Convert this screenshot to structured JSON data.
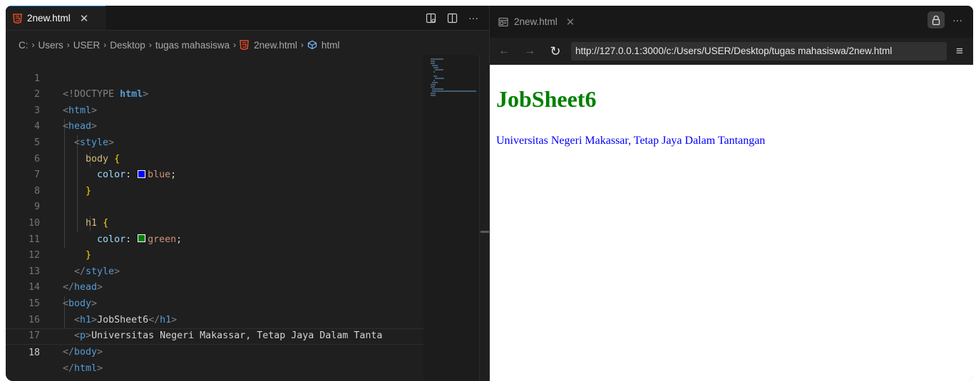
{
  "editor": {
    "tab": {
      "label": "2new.html",
      "close": "✕",
      "icon": "html5-icon"
    },
    "actions": {
      "more": "···"
    },
    "breadcrumb": [
      "C:",
      "Users",
      "USER",
      "Desktop",
      "tugas mahasiswa",
      "2new.html",
      "html"
    ],
    "breadcrumb_sep": "›",
    "active_line": 18,
    "lines": [
      {
        "n": "1"
      },
      {
        "n": "2"
      },
      {
        "n": "3"
      },
      {
        "n": "4"
      },
      {
        "n": "5"
      },
      {
        "n": "6"
      },
      {
        "n": "7"
      },
      {
        "n": "8"
      },
      {
        "n": "9"
      },
      {
        "n": "10"
      },
      {
        "n": "11"
      },
      {
        "n": "12"
      },
      {
        "n": "13"
      },
      {
        "n": "14"
      },
      {
        "n": "15"
      },
      {
        "n": "16"
      },
      {
        "n": "17"
      },
      {
        "n": "18"
      }
    ],
    "code": {
      "doctype_open": "<!DOCTYPE ",
      "doctype_kw": "html",
      "doctype_close": ">",
      "tag_html": "html",
      "tag_head": "head",
      "tag_style": "style",
      "tag_body": "body",
      "tag_h1": "h1",
      "tag_p": "p",
      "sel_body": "body",
      "sel_h1": "h1",
      "brace_open": "{",
      "brace_close": "}",
      "prop_color": "color",
      "colon": ": ",
      "val_blue": "blue",
      "val_green": "green",
      "semi": ";",
      "swatch_blue": "#0000ff",
      "swatch_green": "#008000",
      "h1_text": "JobSheet6",
      "p_text": "Universitas Negeri Makassar, Tetap Jaya Dalam Tanta"
    }
  },
  "browser": {
    "tab": {
      "label": "2new.html",
      "close": "✕",
      "icon": "preview-icon"
    },
    "nav": {
      "back": "←",
      "forward": "→",
      "reload": "↻",
      "menu": "≡"
    },
    "url": "http://127.0.0.1:3000/c:/Users/USER/Desktop/tugas mahasiswa/2new.html",
    "more": "···",
    "page": {
      "heading": "JobSheet6",
      "heading_color": "#008000",
      "paragraph": "Universitas Negeri Makassar, Tetap Jaya Dalam Tantangan",
      "paragraph_color": "#0000ff"
    }
  }
}
